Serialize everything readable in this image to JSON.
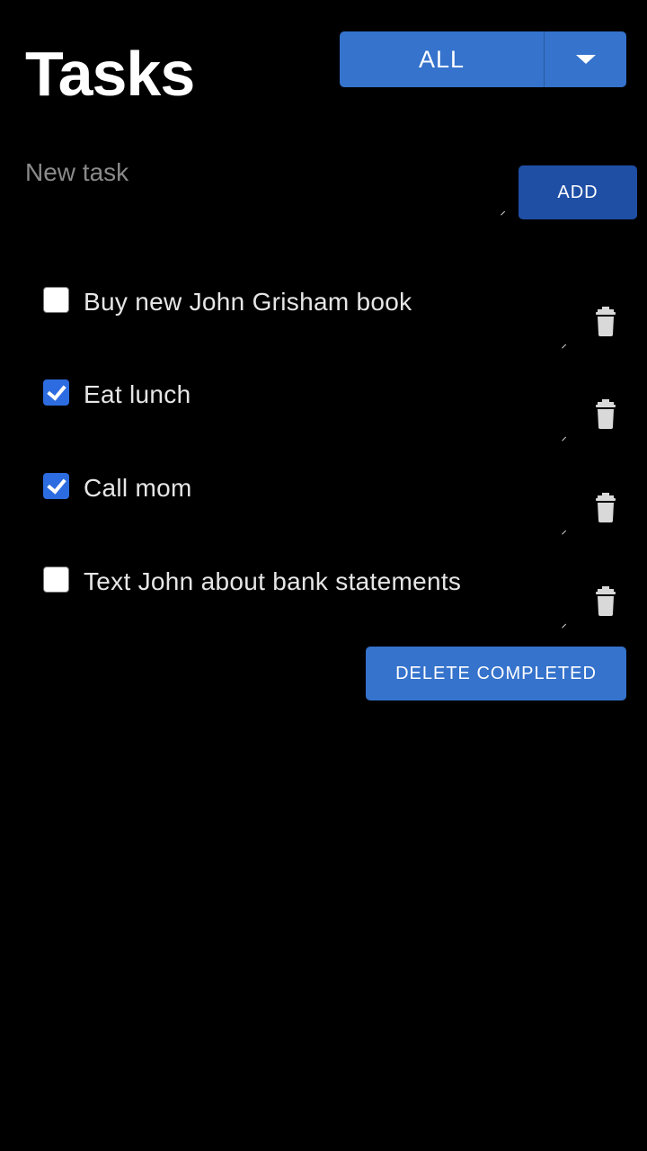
{
  "header": {
    "title": "Tasks"
  },
  "filter": {
    "selected": "ALL",
    "icon": "chevron-down-icon"
  },
  "new_task": {
    "placeholder": "New task",
    "value": "",
    "add_label": "ADD"
  },
  "tasks": [
    {
      "label": "Buy new John Grisham book",
      "completed": false
    },
    {
      "label": "Eat lunch",
      "completed": true
    },
    {
      "label": "Call mom",
      "completed": true
    },
    {
      "label": "Text John about bank statements",
      "completed": false
    }
  ],
  "footer": {
    "delete_completed_label": "DELETE COMPLETED"
  },
  "colors": {
    "background": "#000000",
    "primary": "#3573cc",
    "add_button": "#1f4ea5",
    "checkbox_checked": "#2d6ce0",
    "trash": "#d9d9d9",
    "placeholder": "#8a8a8a"
  }
}
